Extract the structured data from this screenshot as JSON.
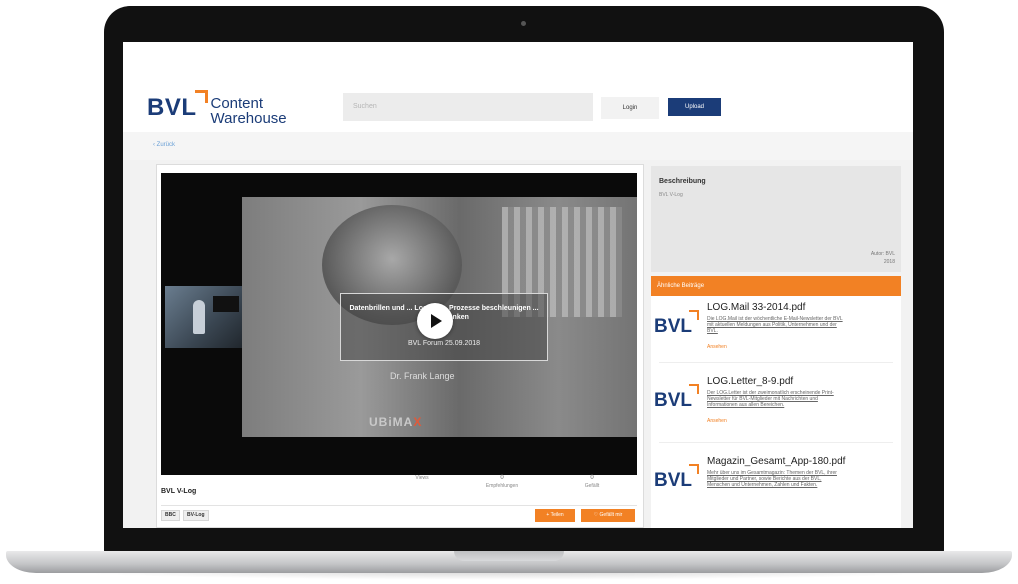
{
  "header": {
    "logo_mark": "BVL",
    "logo_line1": "Content",
    "logo_line2": "Warehouse",
    "search_placeholder": "Suchen",
    "login_label": "Login",
    "upload_label": "Upload"
  },
  "nav": {
    "back_label": "‹ Zurück"
  },
  "video": {
    "overlay_title": "Datenbrillen und ... Logistik – Prozesse beschleunigen ... Kosten senken",
    "overlay_date": "BVL Forum 25.09.2018",
    "speaker": "Dr. Frank Lange",
    "brand": "UBiMA",
    "brand_x": "X",
    "title": "BVL V-Log",
    "stats": [
      {
        "label": "Views",
        "value": ""
      },
      {
        "label": "Empfehlungen",
        "value": "0"
      },
      {
        "label": "Gefällt",
        "value": "0"
      }
    ],
    "tags": [
      "BBC",
      "BV-Log"
    ],
    "action_share": "+ Teilen",
    "action_like": "♡ Gefällt mir"
  },
  "description": {
    "heading": "Beschreibung",
    "text": "BVL V-Log",
    "author": "Autor: BVL",
    "year": "2018"
  },
  "related": {
    "heading": "Ähnliche Beiträge",
    "items": [
      {
        "logo": "BVL",
        "title": "LOG.Mail 33-2014.pdf",
        "desc": "Die LOG.Mail ist der wöchentliche E-Mail-Newsletter der BVL mit aktuellen Meldungen aus Politik, Unternehmen und der BVL.",
        "link": "Ansehen"
      },
      {
        "logo": "BVL",
        "title": "LOG.Letter_8-9.pdf",
        "desc": "Der LOG.Letter ist der zweimonatlich erscheinende Print-Newsletter für BVL-Mitglieder mit Nachrichten und Informationen aus allen Bereichen.",
        "link": "Ansehen"
      },
      {
        "logo": "BVL",
        "title": "Magazin_Gesamt_App-180.pdf",
        "desc": "Mehr über uns im Gesamtmagazin: Themen der BVL, ihrer Mitglieder und Partner, sowie Berichte aus der BVL, Menschen und Unternehmen, Zahlen und Fakten.",
        "link": ""
      }
    ]
  },
  "colors": {
    "brand_blue": "#1b3c78",
    "accent_orange": "#f28124"
  }
}
